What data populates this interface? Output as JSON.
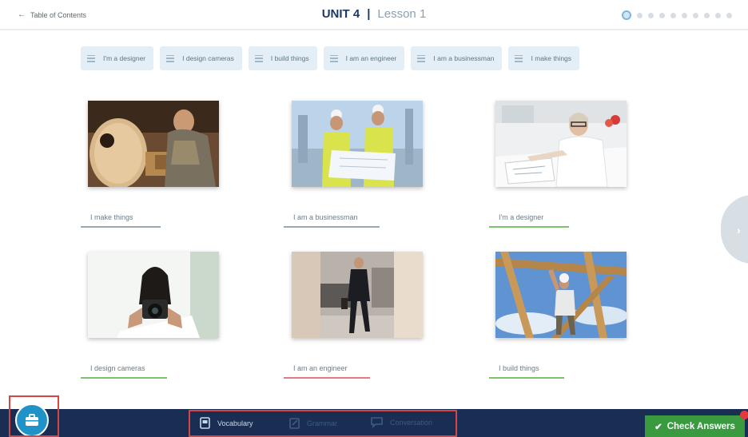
{
  "header": {
    "back_label": "Table of Contents",
    "unit": "UNIT 4",
    "separator": "|",
    "lesson": "Lesson 1",
    "progress": {
      "current": 1,
      "total": 10
    }
  },
  "word_bank": [
    "I'm a designer",
    "I design cameras",
    "I build things",
    "I am an engineer",
    "I am a businessman",
    "I make things"
  ],
  "cards": [
    {
      "image": "guitar-maker-photo",
      "answer": "I make things",
      "status": "neutral"
    },
    {
      "image": "construction-workers-photo",
      "answer": "I am a businessman",
      "status": "neutral"
    },
    {
      "image": "designer-woman-photo",
      "answer": "I'm a designer",
      "status": "correct"
    },
    {
      "image": "camera-designer-photo",
      "answer": "I design cameras",
      "status": "correct"
    },
    {
      "image": "businessman-walking-photo",
      "answer": "I am an engineer",
      "status": "wrong"
    },
    {
      "image": "builder-on-frame-photo",
      "answer": "I build things",
      "status": "correct"
    }
  ],
  "footer": {
    "tabs": [
      {
        "label": "Vocabulary",
        "state": "active"
      },
      {
        "label": "Grammar",
        "state": "disabled"
      },
      {
        "label": "Conversation",
        "state": "disabled"
      }
    ],
    "check_label": "Check Answers"
  },
  "colors": {
    "navy": "#1a2e54",
    "accent_blue": "#1f92c8",
    "correct": "#7cc26a",
    "wrong": "#e57a82",
    "check_green": "#3a9a3f"
  }
}
